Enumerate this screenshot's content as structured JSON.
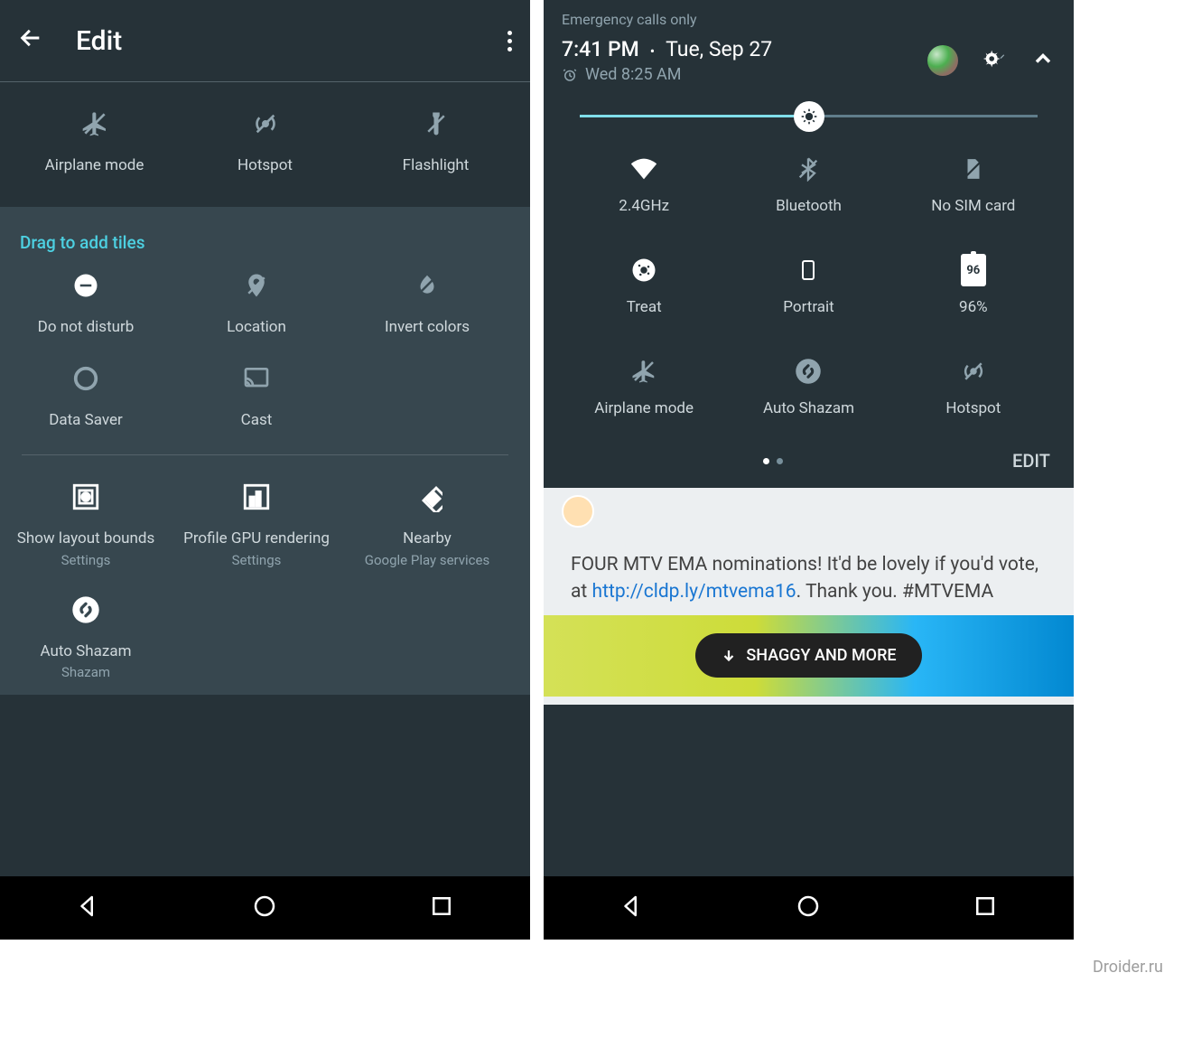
{
  "left": {
    "header": {
      "title": "Edit"
    },
    "top_tiles": [
      {
        "label": "Airplane mode"
      },
      {
        "label": "Hotspot"
      },
      {
        "label": "Flashlight"
      }
    ],
    "drag_title": "Drag to add tiles",
    "available": [
      {
        "label": "Do not disturb"
      },
      {
        "label": "Location"
      },
      {
        "label": "Invert colors"
      },
      {
        "label": "Data Saver"
      },
      {
        "label": "Cast"
      }
    ],
    "third_party": [
      {
        "label": "Show layout bounds",
        "sublabel": "Settings"
      },
      {
        "label": "Profile GPU rendering",
        "sublabel": "Settings"
      },
      {
        "label": "Nearby",
        "sublabel": "Google Play services"
      },
      {
        "label": "Auto Shazam",
        "sublabel": "Shazam"
      }
    ]
  },
  "right": {
    "status": "Emergency calls only",
    "time": "7:41 PM",
    "date": "Tue, Sep 27",
    "alarm": "Wed 8:25 AM",
    "brightness_pct": 50,
    "tiles": [
      {
        "label": "2.4GHz"
      },
      {
        "label": "Bluetooth"
      },
      {
        "label": "No SIM card"
      },
      {
        "label": "Treat"
      },
      {
        "label": "Portrait"
      },
      {
        "label": "96%",
        "batt": "96"
      },
      {
        "label": "Airplane mode"
      },
      {
        "label": "Auto Shazam"
      },
      {
        "label": "Hotspot"
      }
    ],
    "edit": "EDIT",
    "tweet_pre": "FOUR MTV EMA nominations! It'd be lovely if you'd vote, at ",
    "tweet_link": "http://cldp.ly/mtvema16",
    "tweet_post": ". Thank you. #MTVEMA",
    "pill": "SHAGGY AND MORE",
    "watermark": "Droider.ru"
  }
}
